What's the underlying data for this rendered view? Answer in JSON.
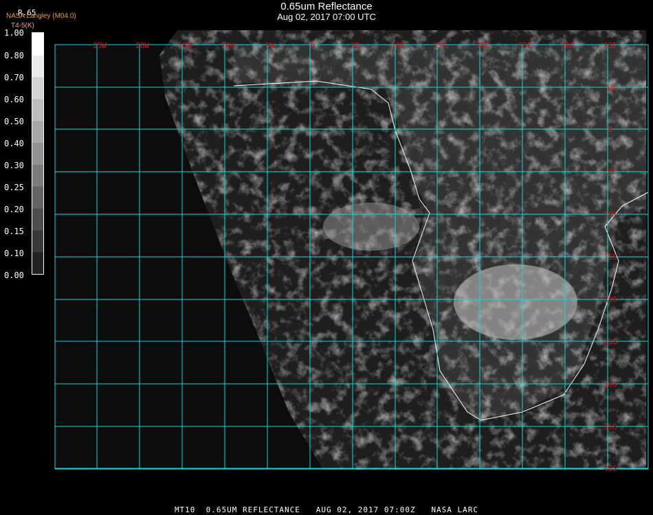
{
  "header": {
    "title": "0.65um Reflectance",
    "subtitle": "Aug 02, 2017 07:00 UTC"
  },
  "legend": {
    "product": "R.65",
    "organization": "NASA Langley (M04.0)",
    "secondary": "T4-5(K)",
    "ticks": [
      "1.00",
      "0.80",
      "0.70",
      "0.60",
      "0.50",
      "0.40",
      "0.30",
      "0.25",
      "0.20",
      "0.15",
      "0.10",
      "0.00"
    ]
  },
  "map": {
    "lon_labels": [
      "25W",
      "20W",
      "15W",
      "10W",
      "5W",
      "0",
      "5E",
      "10E",
      "15E",
      "20E",
      "25E",
      "30E",
      "35E"
    ],
    "lat_labels": [
      "5N",
      "0",
      "5S",
      "10S",
      "15S",
      "20S",
      "25S",
      "30S",
      "35S",
      "40S"
    ],
    "colors": {
      "grid": "#00e0e0",
      "label": "#e01010",
      "coast": "#ffffff"
    }
  },
  "footer": "MT10  0.65UM REFLECTANCE   AUG 02, 2017 07:00Z   NASA LARC"
}
